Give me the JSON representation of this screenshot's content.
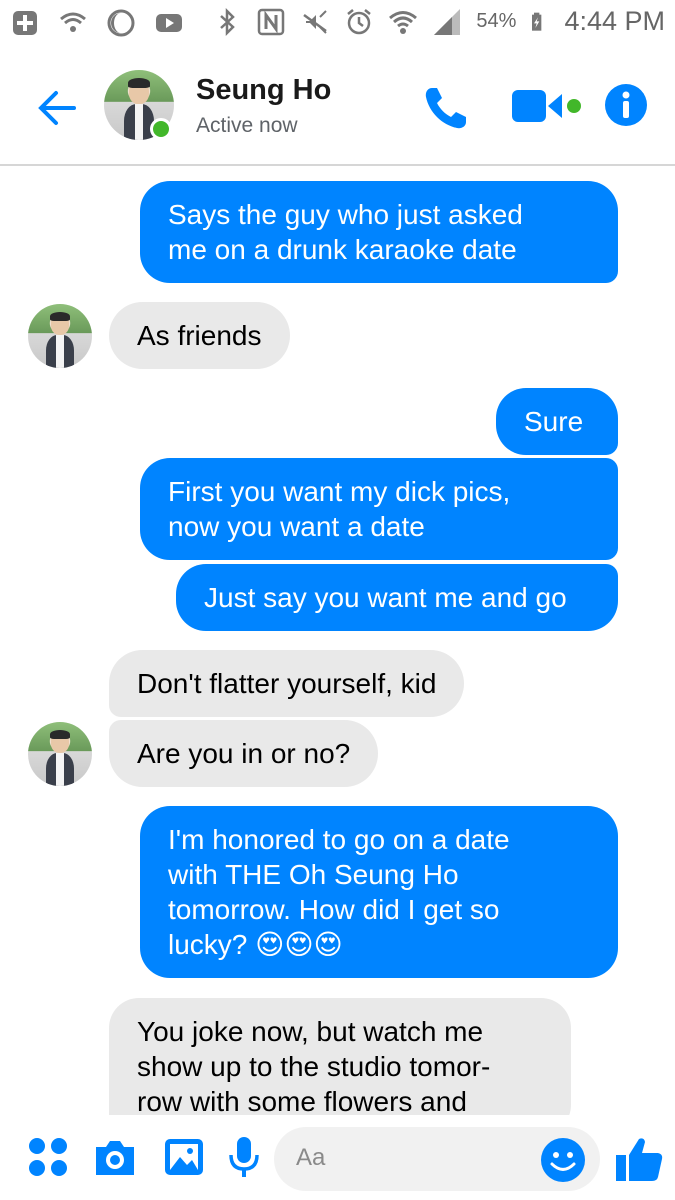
{
  "status_bar": {
    "battery_percent": "54%",
    "time": "4:44 PM",
    "icons": [
      "add-icon",
      "wifi-icon",
      "moon-icon",
      "youtube-icon",
      "bluetooth-icon",
      "nfc-icon",
      "mute-icon",
      "alarm-icon",
      "wifi-icon",
      "signal-icon",
      "battery-icon"
    ]
  },
  "header": {
    "contact_name": "Seung Ho",
    "contact_status": "Active now",
    "accent_color": "#0084ff",
    "active_color": "#42b72a"
  },
  "messages": [
    {
      "direction": "out",
      "text_lines": [
        "Says the guy who just asked",
        "me on a drunk karaoke date"
      ]
    },
    {
      "direction": "in",
      "text_lines": [
        "As friends"
      ]
    },
    {
      "direction": "out",
      "text_lines": [
        "Sure"
      ]
    },
    {
      "direction": "out",
      "text_lines": [
        "First you want my dick pics,",
        "now you want a date"
      ]
    },
    {
      "direction": "out",
      "text_lines": [
        "Just say you want me and go"
      ]
    },
    {
      "direction": "in",
      "text_lines": [
        "Don't flatter yourself, kid"
      ]
    },
    {
      "direction": "in",
      "text_lines": [
        "Are you in or no?"
      ]
    },
    {
      "direction": "out",
      "text_lines": [
        "I'm honored to go on a date",
        "with THE Oh Seung Ho",
        "tomorrow. How did I get so",
        "lucky? 😍😍😍"
      ]
    },
    {
      "direction": "in",
      "text_lines": [
        "You joke now, but watch me",
        "show up to the studio tomor-",
        "row with some flowers and"
      ]
    }
  ],
  "composer": {
    "placeholder": "Aa",
    "icons": [
      "apps-icon",
      "camera-icon",
      "image-icon",
      "microphone-icon",
      "emoji-icon",
      "thumbs-up-icon"
    ]
  }
}
